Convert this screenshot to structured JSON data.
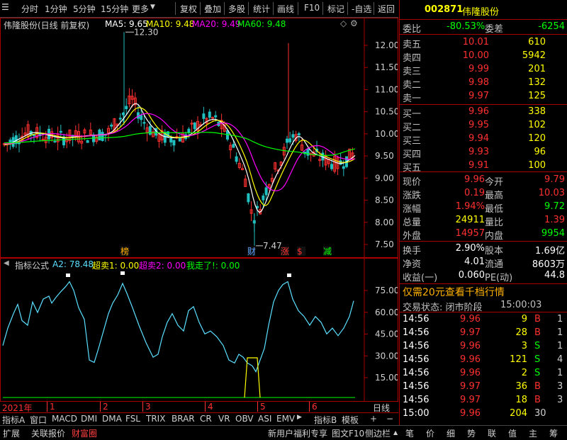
{
  "toolbar": {
    "items": [
      "分时",
      "1分钟",
      "5分钟",
      "15分钟",
      "更多",
      "复权",
      "叠加",
      "多股",
      "统计",
      "画线",
      "F10",
      "标记",
      "-自选",
      "返回"
    ]
  },
  "kline": {
    "title": "伟隆股份(日线 前复权)",
    "ma": [
      {
        "label": "MA5: 9.65",
        "color": "#ffffff"
      },
      {
        "label": "MA10: 9.48",
        "color": "#ffff00"
      },
      {
        "label": "MA20: 9.49",
        "color": "#ff00ff"
      },
      {
        "label": "MA60: 9.48",
        "color": "#00ff00"
      }
    ],
    "y_ticks": [
      "12.00",
      "11.50",
      "11.00",
      "10.50",
      "10.00",
      "9.50",
      "9.00",
      "8.50",
      "8.00",
      "7.50"
    ],
    "high_label": "12.30",
    "low_label": "7.47",
    "markers": [
      {
        "text": "榜",
        "color": "#ffb000"
      },
      {
        "text": "财",
        "color": "#5aa0ff"
      },
      {
        "text": "涨",
        "color": "#ff3030"
      },
      {
        "text": "$",
        "color": "#ff3030"
      },
      {
        "text": "减",
        "color": "#00ff00"
      }
    ]
  },
  "indicator": {
    "title": "指标公式",
    "items": [
      {
        "label": "A2: 78.48",
        "color": "#5ae0ff"
      },
      {
        "label": "超卖1: 0.00",
        "color": "#ffff00"
      },
      {
        "label": "超卖2: 0.00",
        "color": "#ff00ff"
      },
      {
        "label": "我走了!: 0.00",
        "color": "#00ff00"
      }
    ],
    "y_ticks": [
      "75.00",
      "60.00",
      "45.00",
      "30.00",
      "15.00"
    ]
  },
  "timeaxis": {
    "year": "2021年",
    "months": [
      "1",
      "2",
      "3",
      "4",
      "5",
      "6"
    ],
    "period": "日线"
  },
  "tabs": [
    "指标A",
    "窗口",
    "MACD",
    "DMI",
    "DMA",
    "FSL",
    "TRIX",
    "BRAR",
    "CR",
    "VR",
    "OBV",
    "ASI",
    "EMV",
    "指标B",
    "模板",
    "+",
    "−"
  ],
  "bottom": {
    "left": [
      "扩展",
      "关联报价",
      "财富圈"
    ],
    "right": [
      "新用户福利专享",
      "图文F10",
      "侧边栏"
    ],
    "quick": [
      "笔",
      "价",
      "细",
      "势",
      "联",
      "值",
      "主",
      "筹"
    ]
  },
  "quote": {
    "code": "002871",
    "name": "伟隆股份",
    "weibi_label": "委比",
    "weibi": "-80.53%",
    "weicha_label": "委差",
    "weicha": "-6254",
    "asks": [
      {
        "label": "卖五",
        "price": "10.01",
        "vol": "610"
      },
      {
        "label": "卖四",
        "price": "10.00",
        "vol": "5942"
      },
      {
        "label": "卖三",
        "price": "9.99",
        "vol": "201"
      },
      {
        "label": "卖二",
        "price": "9.98",
        "vol": "132"
      },
      {
        "label": "卖一",
        "price": "9.97",
        "vol": "125"
      }
    ],
    "bids": [
      {
        "label": "买一",
        "price": "9.96",
        "vol": "338"
      },
      {
        "label": "买二",
        "price": "9.95",
        "vol": "102"
      },
      {
        "label": "买三",
        "price": "9.94",
        "vol": "120"
      },
      {
        "label": "买四",
        "price": "9.93",
        "vol": "96"
      },
      {
        "label": "买五",
        "price": "9.91",
        "vol": "100"
      }
    ],
    "stats1": [
      {
        "l1": "现价",
        "v1": "9.96",
        "c1": "#ff3030",
        "l2": "今开",
        "v2": "9.79",
        "c2": "#ff3030"
      },
      {
        "l1": "涨跌",
        "v1": "0.19",
        "c1": "#ff3030",
        "l2": "最高",
        "v2": "10.03",
        "c2": "#ff3030"
      },
      {
        "l1": "涨幅",
        "v1": "1.94%",
        "c1": "#ff3030",
        "l2": "最低",
        "v2": "9.72",
        "c2": "#00ff00"
      },
      {
        "l1": "总量",
        "v1": "24911",
        "c1": "#ffff00",
        "l2": "量比",
        "v2": "1.39",
        "c2": "#ff3030"
      },
      {
        "l1": "外盘",
        "v1": "14957",
        "c1": "#ff3030",
        "l2": "内盘",
        "v2": "9954",
        "c2": "#00ff00"
      }
    ],
    "stats2": [
      {
        "l1": "换手",
        "v1": "2.90%",
        "l2": "股本",
        "v2": "1.69亿"
      },
      {
        "l1": "净资",
        "v1": "4.01",
        "l2": "流通",
        "v2": "8603万"
      },
      {
        "l1": "收益(一)",
        "v1": "0.060",
        "l2": "PE(动)",
        "v2": "44.8"
      }
    ],
    "promo": "仅需20元查看千档行情",
    "status_label": "交易状态: 闭市阶段",
    "status_time": "15:00:03",
    "ticks": [
      {
        "t": "14:56",
        "p": "9.96",
        "v": "9",
        "d": "B"
      },
      {
        "t": "14:56",
        "p": "9.97",
        "v": "28",
        "d": "B"
      },
      {
        "t": "14:56",
        "p": "9.96",
        "v": "3",
        "d": "S"
      },
      {
        "t": "14:56",
        "p": "9.96",
        "v": "121",
        "d": "S"
      },
      {
        "t": "14:56",
        "p": "9.96",
        "v": "2",
        "d": "S"
      },
      {
        "t": "14:56",
        "p": "9.97",
        "v": "36",
        "d": "B"
      },
      {
        "t": "14:56",
        "p": "9.97",
        "v": "18",
        "d": "B"
      },
      {
        "t": "15:00",
        "p": "9.96",
        "v": "204",
        "d": "30"
      }
    ],
    "tick_counts": [
      "1",
      "1",
      "1",
      "4",
      "1",
      "3",
      "3",
      ""
    ]
  }
}
